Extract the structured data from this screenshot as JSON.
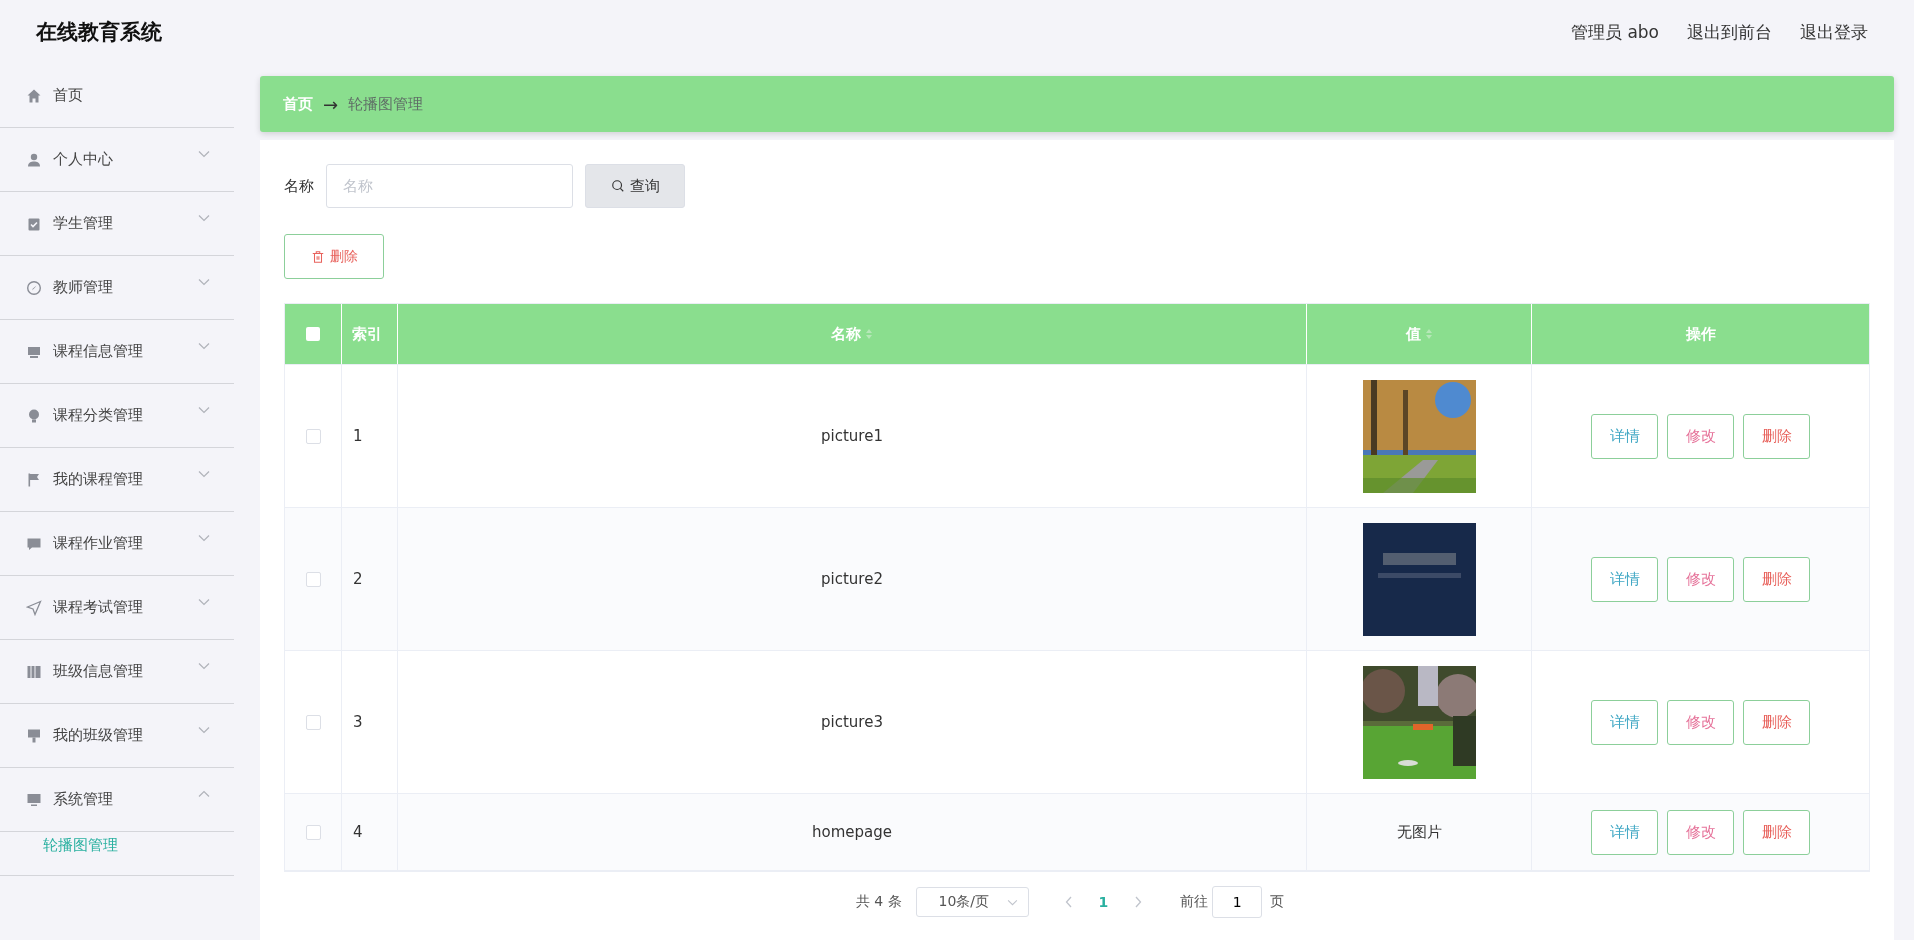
{
  "header": {
    "title": "在线教育系统",
    "user": "管理员 abo",
    "links": [
      "退出到前台",
      "退出登录"
    ]
  },
  "sidebar": {
    "items": [
      {
        "label": "首页"
      },
      {
        "label": "个人中心",
        "expanded": false
      },
      {
        "label": "学生管理",
        "expanded": false
      },
      {
        "label": "教师管理",
        "expanded": false
      },
      {
        "label": "课程信息管理",
        "expanded": false
      },
      {
        "label": "课程分类管理",
        "expanded": false
      },
      {
        "label": "我的课程管理",
        "expanded": false
      },
      {
        "label": "课程作业管理",
        "expanded": false
      },
      {
        "label": "课程考试管理",
        "expanded": false
      },
      {
        "label": "班级信息管理",
        "expanded": false
      },
      {
        "label": "我的班级管理",
        "expanded": false
      },
      {
        "label": "系统管理",
        "expanded": true,
        "children": [
          {
            "label": "轮播图管理",
            "selected": true
          }
        ]
      }
    ]
  },
  "breadcrumb": {
    "home": "首页",
    "separator": "→",
    "current": "轮播图管理"
  },
  "search": {
    "label": "名称",
    "placeholder": "名称",
    "button": "查询"
  },
  "bulk_delete": "删除",
  "table": {
    "header_checked": false,
    "columns": [
      "索引",
      "名称",
      "值",
      "操作"
    ],
    "rows": [
      {
        "checked": false,
        "index": "1",
        "name": "picture1",
        "value": {
          "kind": "picture"
        },
        "actions": [
          "详情",
          "修改",
          "删除"
        ]
      },
      {
        "checked": false,
        "index": "2",
        "name": "picture2",
        "value": {
          "kind": "picture"
        },
        "actions": [
          "详情",
          "修改",
          "删除"
        ]
      },
      {
        "checked": false,
        "index": "3",
        "name": "picture3",
        "value": {
          "kind": "picture"
        },
        "actions": [
          "详情",
          "修改",
          "删除"
        ]
      },
      {
        "checked": false,
        "index": "4",
        "name": "homepage",
        "value": {
          "kind": "text",
          "text": "无图片"
        },
        "actions": [
          "详情",
          "修改",
          "删除"
        ]
      }
    ]
  },
  "pagination": {
    "total": "共 4 条",
    "page_size": "10条/页",
    "pages": [
      {
        "label": "1",
        "selected": true
      }
    ],
    "goto_label": "前往",
    "goto_value": "1",
    "goto_suffix": "页"
  }
}
